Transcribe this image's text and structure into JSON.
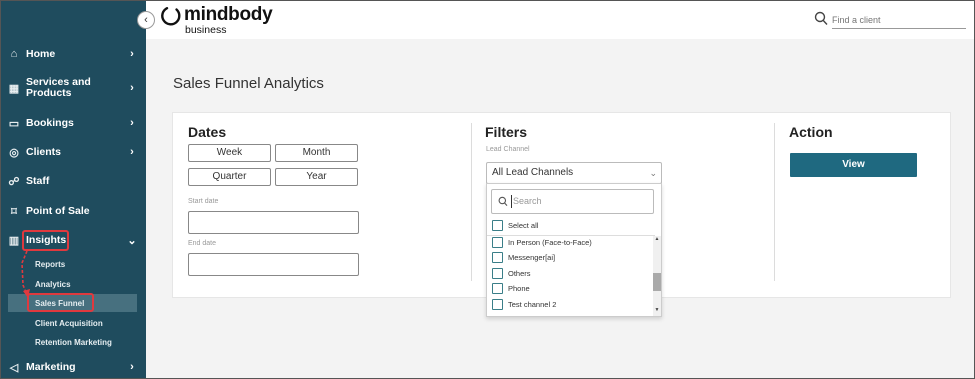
{
  "brand": {
    "name": "mindbody",
    "sub": "business"
  },
  "header": {
    "search_placeholder": "Find a client"
  },
  "sidebar": {
    "items": [
      {
        "label": "Home",
        "icon": "home-icon"
      },
      {
        "label": "Services and Products",
        "icon": "grid-icon"
      },
      {
        "label": "Bookings",
        "icon": "calendar-icon"
      },
      {
        "label": "Clients",
        "icon": "user-circle-icon"
      },
      {
        "label": "Staff",
        "icon": "people-icon"
      },
      {
        "label": "Point of Sale",
        "icon": "tag-icon"
      },
      {
        "label": "Insights",
        "icon": "bar-chart-icon",
        "expanded": true
      },
      {
        "label": "Marketing",
        "icon": "megaphone-icon"
      }
    ],
    "insights_sub": [
      "Reports",
      "Analytics",
      "Sales Funnel",
      "Client Acquisition",
      "Retention Marketing"
    ],
    "active_sub": "Sales Funnel"
  },
  "page": {
    "title": "Sales Funnel Analytics"
  },
  "dates": {
    "title": "Dates",
    "buttons": [
      "Week",
      "Month",
      "Quarter",
      "Year"
    ],
    "start_label": "Start date",
    "end_label": "End date"
  },
  "filters": {
    "title": "Filters",
    "lead_channel_label": "Lead Channel",
    "selected": "All Lead Channels",
    "dropdown": {
      "search_placeholder": "Search",
      "select_all": "Select all",
      "options": [
        "In Person (Face-to-Face)",
        "Messenger[ai]",
        "Others",
        "Phone",
        "Test channel 2"
      ]
    }
  },
  "action": {
    "title": "Action",
    "view_label": "View"
  },
  "colors": {
    "sidebar": "#1f4c5e",
    "accent": "#1f6980",
    "highlight": "#e0393e"
  }
}
